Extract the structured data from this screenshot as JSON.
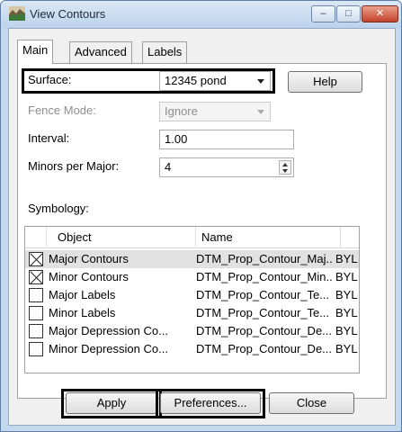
{
  "window": {
    "title": "View Contours"
  },
  "titlebar": {
    "minimize": "–",
    "maximize": "□",
    "close": "✕"
  },
  "tabs": [
    {
      "label": "Main"
    },
    {
      "label": "Advanced"
    },
    {
      "label": "Labels"
    }
  ],
  "main": {
    "surface": {
      "label": "Surface:",
      "value": "12345 pond"
    },
    "help_button": "Help",
    "fence_mode": {
      "label": "Fence Mode:",
      "value": "Ignore"
    },
    "interval": {
      "label": "Interval:",
      "value": "1.00"
    },
    "minors_per_major": {
      "label": "Minors per Major:",
      "value": "4"
    },
    "symbology": {
      "label": "Symbology:",
      "columns": [
        "Object",
        "Name"
      ],
      "rows": [
        {
          "checked": true,
          "object": "Major Contours",
          "name": "DTM_Prop_Contour_Maj..",
          "level": "BYL"
        },
        {
          "checked": true,
          "object": "Minor Contours",
          "name": "DTM_Prop_Contour_Min..",
          "level": "BYL"
        },
        {
          "checked": false,
          "object": "Major Labels",
          "name": "DTM_Prop_Contour_Te...",
          "level": "BYL"
        },
        {
          "checked": false,
          "object": "Minor Labels",
          "name": "DTM_Prop_Contour_Te...",
          "level": "BYL"
        },
        {
          "checked": false,
          "object": "Major Depression Co...",
          "name": "DTM_Prop_Contour_De...",
          "level": "BYL"
        },
        {
          "checked": false,
          "object": "Minor Depression Co...",
          "name": "DTM_Prop_Contour_De...",
          "level": "BYL"
        }
      ]
    }
  },
  "footer": {
    "apply": "Apply",
    "preferences": "Preferences...",
    "close": "Close"
  },
  "colors": {
    "highlight_outline": "#000000",
    "window_frame": "#c4d8ee",
    "selected_row": "#e1e1e1"
  }
}
